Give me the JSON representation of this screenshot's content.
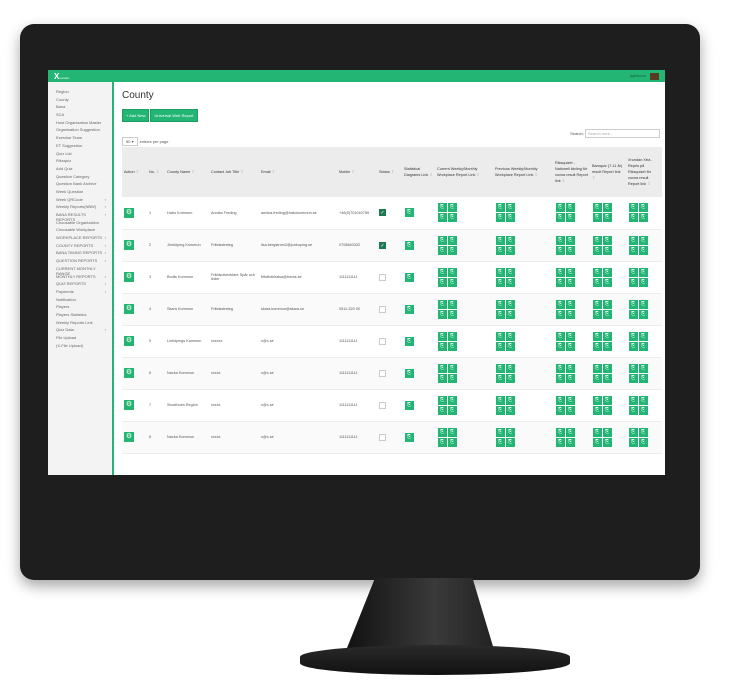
{
  "app": {
    "logo": "X",
    "logo_sub": "ounden",
    "user": "jaybechoo",
    "accent": "#23b574"
  },
  "sidebar": {
    "items": [
      {
        "label": "Region"
      },
      {
        "label": "County"
      },
      {
        "label": "Bana"
      },
      {
        "label": "SCA"
      },
      {
        "label": "Host Organization Master"
      },
      {
        "label": "Organisation Suggestion"
      },
      {
        "label": "Exercise Team"
      },
      {
        "label": "ET Suggestion"
      },
      {
        "label": "Quiz List"
      },
      {
        "label": "Riksquiz"
      },
      {
        "label": "Add Quiz"
      },
      {
        "label": "Question Category"
      },
      {
        "label": "Question Bank Archive"
      },
      {
        "label": "Week Question"
      },
      {
        "label": "Week QRCode",
        "sub": true
      },
      {
        "label": "Weekly Reports(NBW)",
        "sub": true
      },
      {
        "label": "BANA RESULTS REPORTS",
        "sub": true
      },
      {
        "label": "Choosable Organization"
      },
      {
        "label": "Choosable Workplace"
      },
      {
        "label": "WORKPLACE REPORTS",
        "sub": true
      },
      {
        "label": "COUNTY REPORTS",
        "sub": true
      },
      {
        "label": "BANA TIMING REPORTS",
        "sub": true
      },
      {
        "label": "QUESTION REPORTS",
        "sub": true
      },
      {
        "label": "CURRENT MONTHLY RANGE"
      },
      {
        "label": "MONTHLY REPORTS",
        "sub": true
      },
      {
        "label": "QUIZ REPORTS",
        "sub": true
      },
      {
        "label": "Payments",
        "sub": true
      },
      {
        "label": "Notification"
      },
      {
        "label": "Players"
      },
      {
        "label": "Players Statistics"
      },
      {
        "label": "Weekly Reports Link"
      },
      {
        "label": "Quiz Data",
        "sub": true
      },
      {
        "label": "File Upload"
      },
      {
        "label": "(X-File Upload)"
      }
    ]
  },
  "page": {
    "title": "County",
    "add_new": "+ Add New",
    "universal_report": "Universal Web Report",
    "entries_value": "50",
    "entries_label": "entries per page",
    "search_label": "Search:",
    "search_placeholder": "Search here..."
  },
  "table": {
    "columns": [
      "Action",
      "No.",
      "County Name",
      "Contact Job Title",
      "Email",
      "Mobile",
      "Status",
      "Statistical Diagrams Link",
      "Current Weekly/Monthly Workplace Report Link",
      "Previous Weekly/Monthly Workplace Report Link",
      "Riksquizet - Nationell tävling för vuxna result Report link",
      "Bamquiz (7-11 år) result Report link",
      "Xrundan Xtra - Repris på Riksquizet för vuxna result Report link"
    ],
    "rows": [
      {
        "no": "1",
        "county": "Habo Kommun",
        "title": "Annika Freding",
        "email": "annika.freding@habokommun.se",
        "mobile": "+46(0)701040789",
        "status": true
      },
      {
        "no": "2",
        "county": "Jönköping Kommun",
        "title": "Fritidsstrateg",
        "email": "lisa.bergstrom2@jonkoping.se",
        "mobile": "0708640332",
        "status": true
      },
      {
        "no": "3",
        "county": "Borås Kommun",
        "title": "Fritidsutvecklare Spår och leder",
        "email": "fritidfolkhalsa@boras.se",
        "mobile": "1111111111",
        "status": false
      },
      {
        "no": "4",
        "county": "Skara Kommun",
        "title": "Fritidsstrateg",
        "email": "skara.kommun@skara.se",
        "mobile": "0511-320 00",
        "status": false
      },
      {
        "no": "5",
        "county": "Linköpings Kommun",
        "title": "xxxxxx",
        "email": "x@x.se",
        "mobile": "1111111111",
        "status": false
      },
      {
        "no": "6",
        "county": "Nacka Kommun",
        "title": "xxxxx",
        "email": "x@x.se",
        "mobile": "1111111111",
        "status": false
      },
      {
        "no": "7",
        "county": "Stockholm Region",
        "title": "xxxxx",
        "email": "x@x.se",
        "mobile": "1111111111",
        "status": false
      },
      {
        "no": "8",
        "county": "Nacka Kommun",
        "title": "xxxxx",
        "email": "x@x.se",
        "mobile": "1111111111",
        "status": false
      }
    ]
  }
}
